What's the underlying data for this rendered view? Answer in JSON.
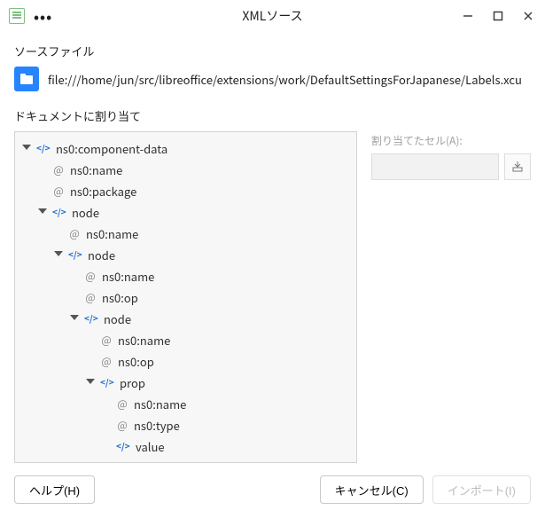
{
  "window": {
    "title": "XMLソース",
    "menu_dots": "•••"
  },
  "source": {
    "label": "ソースファイル",
    "path": "file:///home/jun/src/libreoffice/extensions/work/DefaultSettingsForJapanese/Labels.xcu"
  },
  "assign": {
    "label": "ドキュメントに割り当て",
    "cell_label": "割り当てたセル(A):",
    "cell_value": ""
  },
  "tree": {
    "n0": "ns0:component-data",
    "n0a0": "ns0:name",
    "n0a1": "ns0:package",
    "n1": "node",
    "n1a0": "ns0:name",
    "n2": "node",
    "n2a0": "ns0:name",
    "n2a1": "ns0:op",
    "n3": "node",
    "n3a0": "ns0:name",
    "n3a1": "ns0:op",
    "n4": "prop",
    "n4a0": "ns0:name",
    "n4a1": "ns0:type",
    "n5": "value"
  },
  "buttons": {
    "help": "ヘルプ(H)",
    "cancel": "キャンセル(C)",
    "import": "インポート(I)"
  }
}
